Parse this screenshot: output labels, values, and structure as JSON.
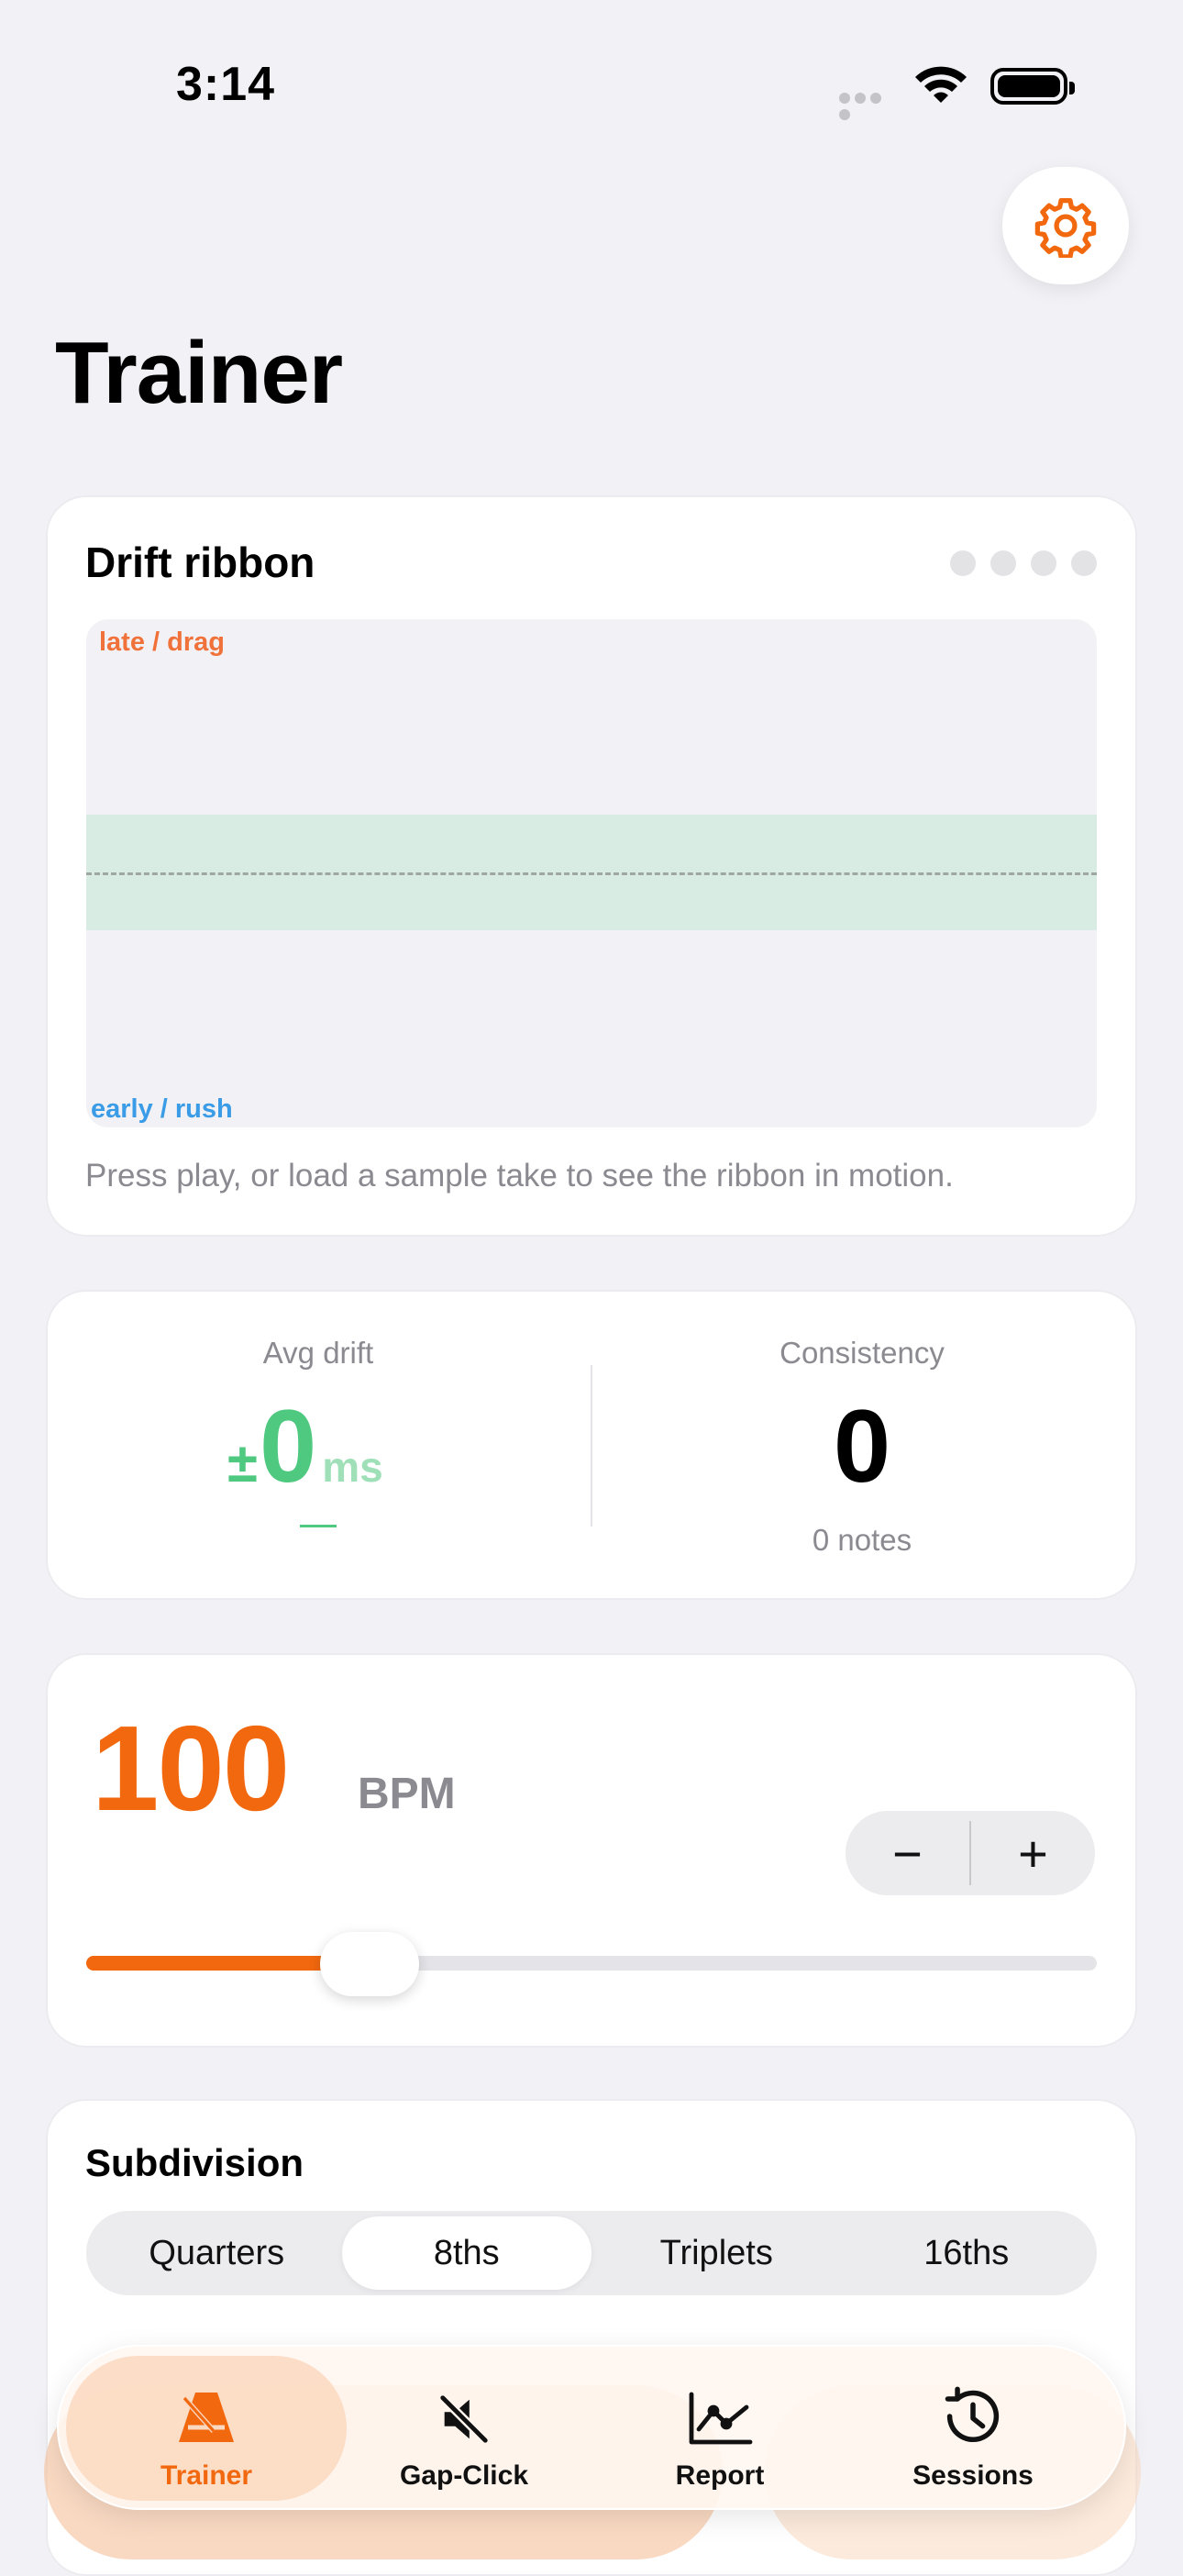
{
  "status_bar": {
    "time": "3:14"
  },
  "page": {
    "title": "Trainer"
  },
  "drift_ribbon": {
    "title": "Drift ribbon",
    "late_label": "late / drag",
    "early_label": "early / rush",
    "hint": "Press play, or load a sample take to see the ribbon in motion."
  },
  "stats": {
    "avg_drift_label": "Avg drift",
    "avg_drift_prefix": "±",
    "avg_drift_value": "0",
    "avg_drift_unit": "ms",
    "consistency_label": "Consistency",
    "consistency_value": "0",
    "notes_count": "0 notes"
  },
  "tempo": {
    "bpm": "100",
    "unit": "BPM",
    "decrement": "−",
    "increment": "+",
    "slider_fraction": 0.28
  },
  "subdivision": {
    "title": "Subdivision",
    "options": [
      "Quarters",
      "8ths",
      "Triplets",
      "16ths"
    ],
    "selected": "8ths"
  },
  "tabs": [
    {
      "label": "Trainer",
      "icon": "metronome-icon",
      "active": true
    },
    {
      "label": "Gap-Click",
      "icon": "speaker-mute-icon",
      "active": false
    },
    {
      "label": "Report",
      "icon": "line-chart-icon",
      "active": false
    },
    {
      "label": "Sessions",
      "icon": "history-clock-icon",
      "active": false
    }
  ],
  "colors": {
    "accent": "#f2680f",
    "good": "#4fc97f",
    "late": "#f0713a",
    "early": "#3a9be6"
  }
}
